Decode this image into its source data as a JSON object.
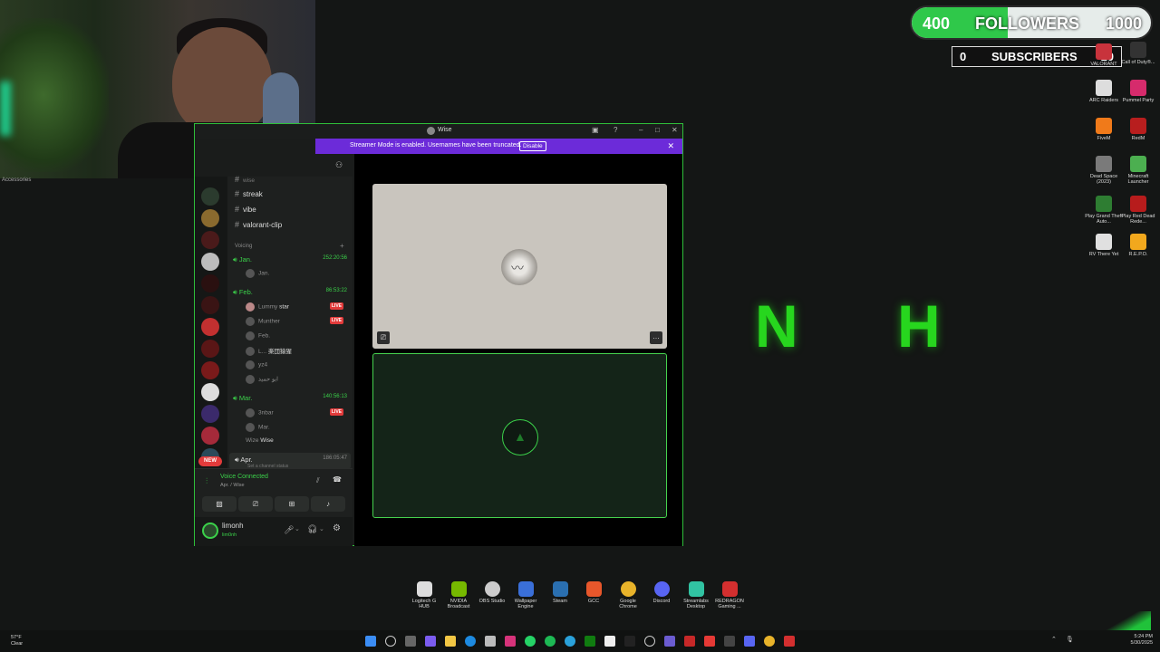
{
  "overlay": {
    "followers": {
      "current": "400",
      "label": "FOLLOWERS",
      "goal": "1000",
      "progress": 0.4
    },
    "subscribers": {
      "current": "0",
      "label": "SUBSCRIBERS",
      "goal": "10"
    },
    "webcam_caption": "Accessories",
    "big_letters": [
      "N",
      "H"
    ]
  },
  "desktop_icons": [
    {
      "label": "VALORANT",
      "color": "#c8333c"
    },
    {
      "label": "Call of Duty®...",
      "color": "#333333"
    },
    {
      "label": "ARC Raiders",
      "color": "#dddddd"
    },
    {
      "label": "Pummel Party",
      "color": "#d62b6c"
    },
    {
      "label": "FiveM",
      "color": "#f07a1a"
    },
    {
      "label": "RedM",
      "color": "#b81e1e"
    },
    {
      "label": "Dead Space (2023)",
      "color": "#7a7a7a"
    },
    {
      "label": "Minecraft Launcher",
      "color": "#4caf50"
    },
    {
      "label": "Play Grand Theft Auto...",
      "color": "#2e7d32"
    },
    {
      "label": "Play Red Dead Rede...",
      "color": "#b71c1c"
    },
    {
      "label": "RV There Yet",
      "color": "#e0e0e0"
    },
    {
      "label": "R.E.P.O.",
      "color": "#f2a81d"
    }
  ],
  "discord": {
    "window_title": "Wise",
    "banner": {
      "text": "Streamer Mode is enabled. Usernames have been truncated.",
      "button": "Disable"
    },
    "text_channels": [
      "wise",
      "streak",
      "vibe",
      "valorant-clip"
    ],
    "voice_category": "Voicing",
    "voice_channels": [
      {
        "name": "Jan.",
        "time": "252:20:56",
        "users": [
          {
            "name": "Jan.",
            "live": false
          }
        ]
      },
      {
        "name": "Feb.",
        "time": "86:53:22",
        "users": [
          {
            "name": "Lummy",
            "extra": "star",
            "live": true
          },
          {
            "name": "Munther",
            "live": true
          },
          {
            "name": "Feb.",
            "live": false
          },
          {
            "name": "L...",
            "extra": "楽団猿猩",
            "live": false
          },
          {
            "name": "yz4",
            "live": false
          },
          {
            "name": "ابو حميد",
            "live": false
          }
        ]
      },
      {
        "name": "Mar.",
        "time": "140:56:13",
        "users": [
          {
            "name": "3nbar",
            "live": true
          },
          {
            "name": "Mar.",
            "live": false
          },
          {
            "name": "Wize",
            "extra": "Wise",
            "live": false
          }
        ]
      },
      {
        "name": "Apr.",
        "time": "186:05:47",
        "status": "Set a channel status",
        "users": []
      }
    ],
    "new_badge": "NEW",
    "voice_status": {
      "title": "Voice Connected",
      "subtitle": "Apr. / Wise"
    },
    "user": {
      "name": "limonh",
      "tag": "lim0nh"
    }
  },
  "dock": [
    {
      "label": "Logitech G HUB",
      "color": "#dddddd"
    },
    {
      "label": "NVIDIA Broadcast",
      "color": "#76b900"
    },
    {
      "label": "OBS Studio",
      "color": "#cccccc"
    },
    {
      "label": "Wallpaper Engine",
      "color": "#3a6fd8"
    },
    {
      "label": "Steam",
      "color": "#2a6fb0"
    },
    {
      "label": "GCC",
      "color": "#e8572b"
    },
    {
      "label": "Google Chrome",
      "color": "#e8b32a"
    },
    {
      "label": "Discord",
      "color": "#5865f2"
    },
    {
      "label": "Streamlabs Desktop",
      "color": "#31c3a2"
    },
    {
      "label": "REDRAGON Gaming ...",
      "color": "#d32f2f"
    }
  ],
  "taskbar": {
    "weather": {
      "temp": "57°F",
      "condition": "Clear"
    },
    "time": "5:24 PM",
    "date": "5/30/2025"
  }
}
